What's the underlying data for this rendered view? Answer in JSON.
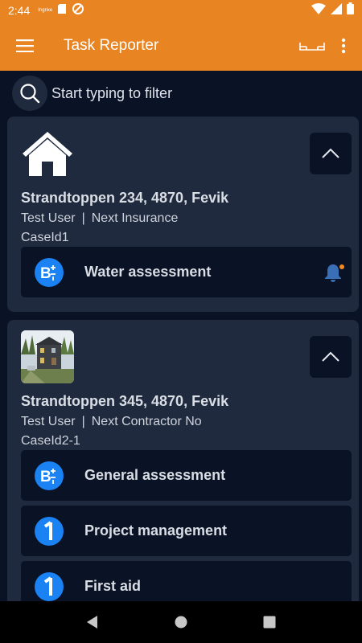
{
  "status_bar": {
    "time": "2:44",
    "tiny_label": "Ingrixe"
  },
  "app_bar": {
    "title": "Task Reporter"
  },
  "filter": {
    "placeholder": "Start typing to filter"
  },
  "cases": [
    {
      "icon": "house-icon",
      "address": "Strandtoppen 234, 4870, Fevik",
      "user": "Test User",
      "separator": "|",
      "company": "Next Insurance",
      "case_id": "CaseId1",
      "tasks": [
        {
          "icon": "b-plus-minus-icon",
          "label": "Water assessment",
          "has_notification": true
        }
      ]
    },
    {
      "icon": "house-photo",
      "address": "Strandtoppen 345, 4870, Fevik",
      "user": "Test User",
      "separator": "|",
      "company": "Next Contractor No",
      "case_id": "CaseId2-1",
      "tasks": [
        {
          "icon": "b-plus-minus-icon",
          "label": "General assessment",
          "has_notification": false
        },
        {
          "icon": "number-one-icon",
          "label": "Project management",
          "has_notification": false
        },
        {
          "icon": "number-one-icon",
          "label": "First aid",
          "has_notification": false
        }
      ]
    }
  ],
  "colors": {
    "accent": "#e98422",
    "background": "#0a1226",
    "card": "#1f2a3e",
    "task_icon": "#1a82f2",
    "notification_dot": "#f28a1e"
  }
}
